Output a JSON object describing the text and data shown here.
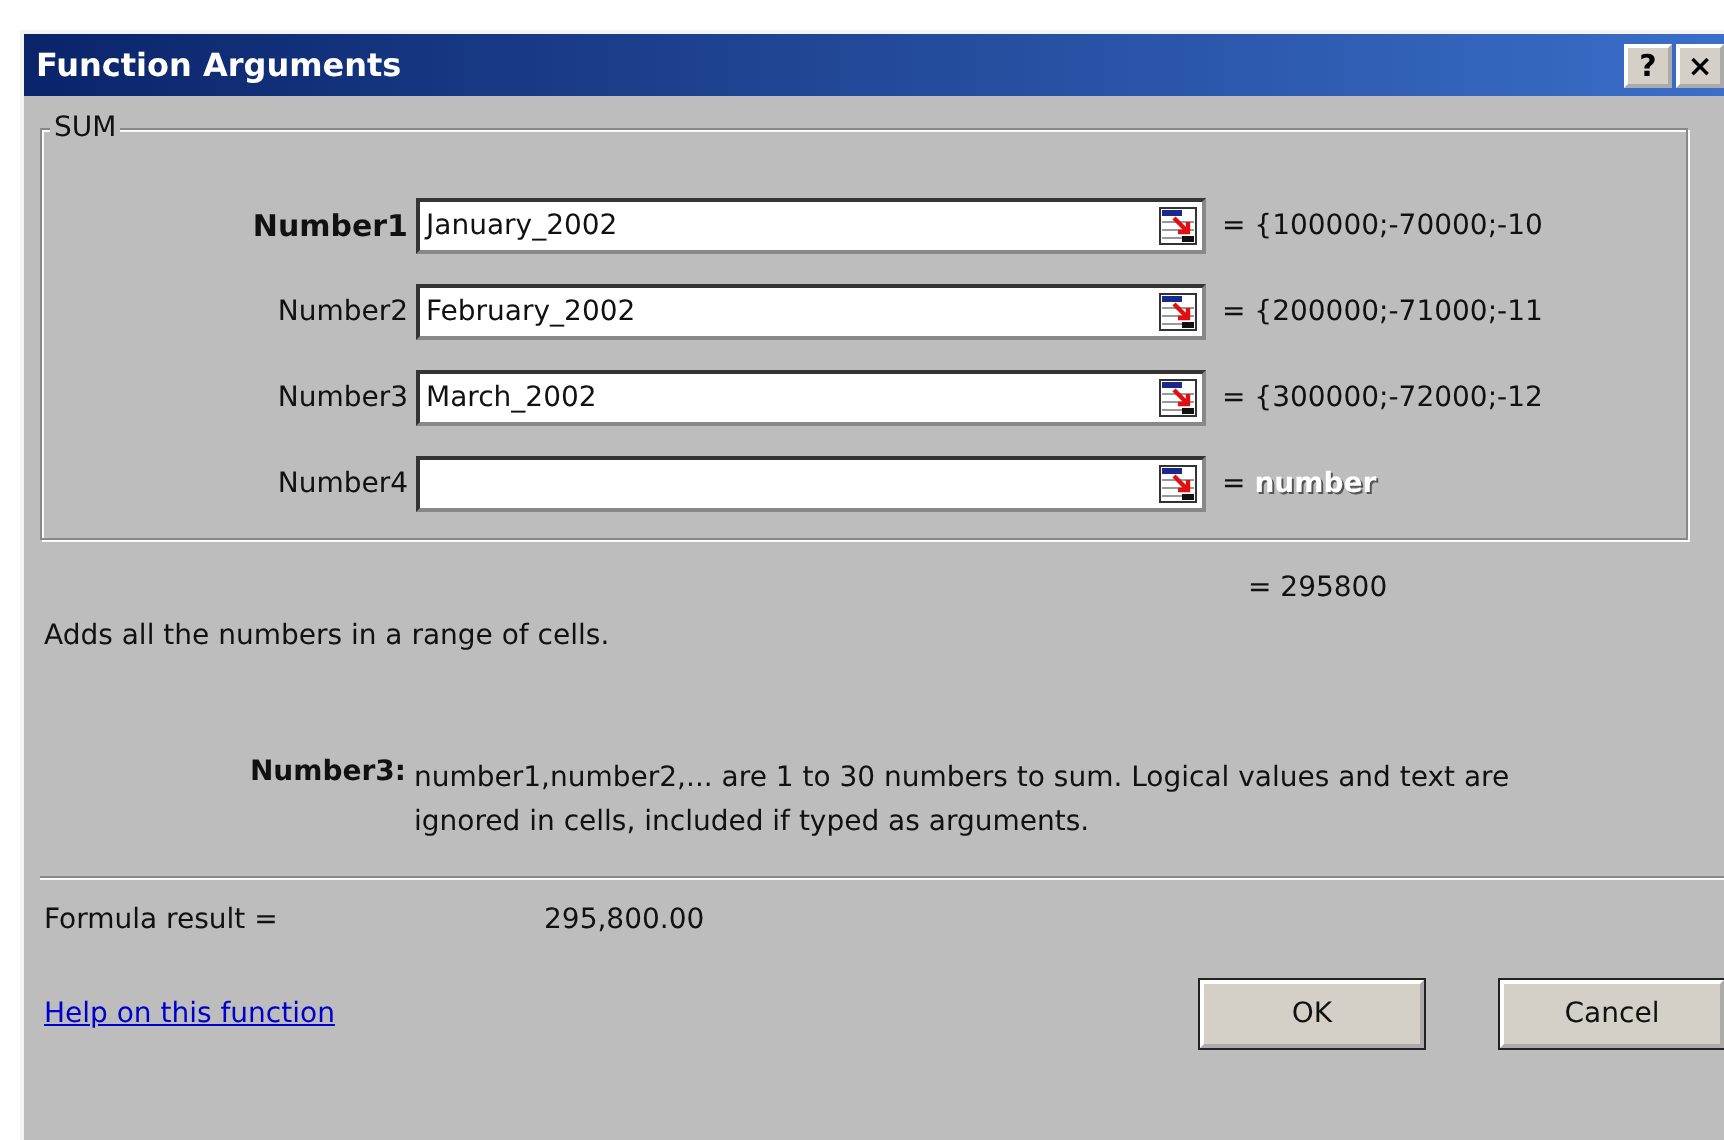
{
  "window": {
    "title": "Function Arguments",
    "buttons": [
      "?",
      "×"
    ]
  },
  "group": {
    "label": "SUM",
    "arguments": [
      {
        "label": "Number1",
        "required": true,
        "value": "January_2002",
        "result": "= {100000;-70000;-10",
        "result_dimmed": false
      },
      {
        "label": "Number2",
        "required": false,
        "value": "February_2002",
        "result": "= {200000;-71000;-11",
        "result_dimmed": false
      },
      {
        "label": "Number3",
        "required": false,
        "value": "March_2002",
        "result": "= {300000;-72000;-12",
        "result_dimmed": false
      },
      {
        "label": "Number4",
        "required": false,
        "result_prefix": "=",
        "result": "number",
        "result_dimmed": true
      }
    ]
  },
  "function_result": "= 295800",
  "description": "Adds all the numbers in a range of cells.",
  "argument_help": {
    "label": "Number3:",
    "text": "number1,number2,... are 1 to 30 numbers to sum. Logical values and text are ignored in cells, included if typed as arguments."
  },
  "formula_result": {
    "label": "Formula result =",
    "value": "295,800.00"
  },
  "help_link": "Help on this function",
  "buttons": [
    "OK",
    "Cancel"
  ]
}
